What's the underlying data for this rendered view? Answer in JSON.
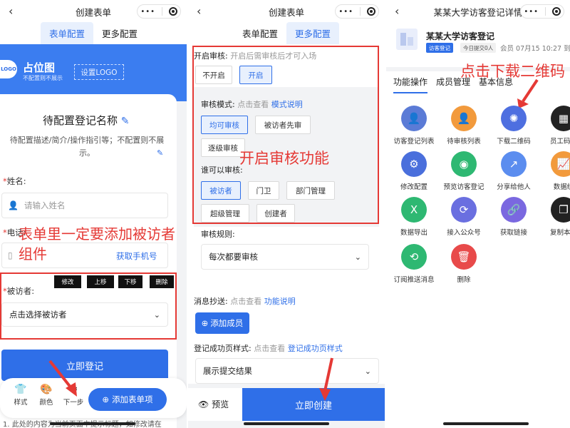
{
  "panel1": {
    "nav_title": "创建表单",
    "tabs": [
      "表单配置",
      "更多配置"
    ],
    "logo_text": "LOGO",
    "placeholder_title": "占位图",
    "placeholder_sub": "不配置则不展示",
    "set_logo": "设置LOGO",
    "form_title": "待配置登记名称",
    "form_desc": "待配置描述/简介/操作指引等；不配置则不展示。",
    "name_label": "姓名:",
    "name_placeholder": "请输入姓名",
    "phone_label": "电话:",
    "get_phone": "获取手机号",
    "visitee_label": "被访者:",
    "visitee_select": "点击选择被访者",
    "tool_buttons": [
      "修改",
      "上移",
      "下移",
      "删除"
    ],
    "annotation": "表单里一定要添加被访者组件",
    "submit": "立即登记",
    "bottom_items": [
      "样式",
      "颜色",
      "下一步"
    ],
    "add_item": "添加表单项",
    "footer_text": "1. 此处的内容为当前页面中提示标题，如修改请在"
  },
  "panel2": {
    "nav_title": "创建表单",
    "tabs": [
      "表单配置",
      "更多配置"
    ],
    "audit_label": "开启审核:",
    "audit_hint": "开启后需审核后才可入场",
    "audit_options": [
      "不开启",
      "开启"
    ],
    "mode_label": "审核模式:",
    "mode_hint": "点击查看",
    "mode_link": "模式说明",
    "mode_options": [
      "均可审核",
      "被访者先审",
      "逐级审核"
    ],
    "who_label": "谁可以审核:",
    "who_options": [
      "被访者",
      "门卫",
      "部门管理",
      "超级管理",
      "创建者"
    ],
    "annotation": "开启审核功能",
    "rule_label": "审核规则:",
    "rule_value": "每次都要审核",
    "cc_label": "消息抄送:",
    "cc_hint": "点击查看",
    "cc_link": "功能说明",
    "add_member": "添加成员",
    "success_label": "登记成功页样式:",
    "success_hint": "点击查看",
    "success_link": "登记成功页样式",
    "success_value": "展示提交结果",
    "preview": "预览",
    "create": "立即创建"
  },
  "panel3": {
    "nav_title": "某某大学访客登记详情",
    "title": "某某大学访客登记",
    "badge": "访客登记",
    "today": "今日提交0人",
    "meta": "会员 07月15 10:27 到",
    "tabs": [
      "功能操作",
      "成员管理",
      "基本信息"
    ],
    "annotation": "点击下载二维码",
    "items": [
      {
        "label": "访客登记列表",
        "color": "#5b7bd6",
        "icon": "👤"
      },
      {
        "label": "待审核列表",
        "color": "#f29a3c",
        "icon": "👤"
      },
      {
        "label": "下载二维码",
        "color": "#4e6fe0",
        "icon": "✺"
      },
      {
        "label": "员工码下",
        "color": "#222222",
        "icon": "▦"
      },
      {
        "label": "修改配置",
        "color": "#4a6fdc",
        "icon": "⚙"
      },
      {
        "label": "预览访客登记",
        "color": "#2eb872",
        "icon": "◉"
      },
      {
        "label": "分享给他人",
        "color": "#5b8def",
        "icon": "↗"
      },
      {
        "label": "数据统",
        "color": "#f29a3c",
        "icon": "📈"
      },
      {
        "label": "数据导出",
        "color": "#2eb872",
        "icon": "X"
      },
      {
        "label": "接入公众号",
        "color": "#6a6fe0",
        "icon": "⟳"
      },
      {
        "label": "获取链接",
        "color": "#7a68e0",
        "icon": "🔗"
      },
      {
        "label": "复制本表",
        "color": "#222222",
        "icon": "❐"
      },
      {
        "label": "订阅推送消息",
        "color": "#2eb872",
        "icon": "⟲"
      },
      {
        "label": "删除",
        "color": "#e84a4a",
        "icon": "🗑"
      }
    ]
  }
}
